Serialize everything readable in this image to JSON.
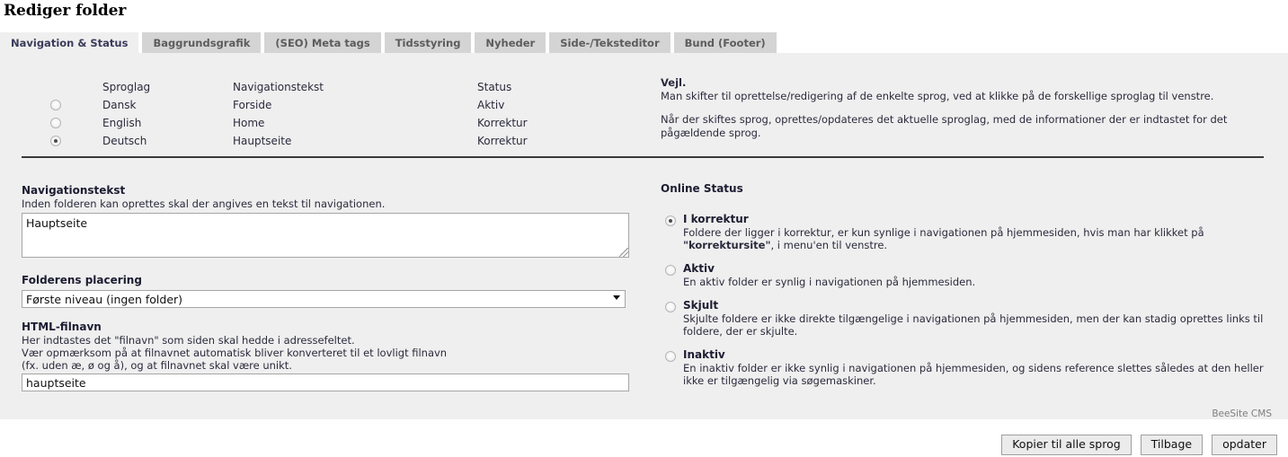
{
  "page": {
    "title": "Rediger folder",
    "brand": "BeeSite CMS"
  },
  "tabs": [
    {
      "label": "Navigation & Status",
      "active": true
    },
    {
      "label": "Baggrundsgrafik",
      "active": false
    },
    {
      "label": "(SEO) Meta tags",
      "active": false
    },
    {
      "label": "Tidsstyring",
      "active": false
    },
    {
      "label": "Nyheder",
      "active": false
    },
    {
      "label": "Side-/Teksteditor",
      "active": false
    },
    {
      "label": "Bund (Footer)",
      "active": false
    }
  ],
  "lang_table": {
    "headers": {
      "sproglag": "Sproglag",
      "navigationstekst": "Navigationstekst",
      "status": "Status"
    },
    "rows": [
      {
        "language": "Dansk",
        "nav_text": "Forside",
        "status": "Aktiv",
        "selected": false
      },
      {
        "language": "English",
        "nav_text": "Home",
        "status": "Korrektur",
        "selected": false
      },
      {
        "language": "Deutsch",
        "nav_text": "Hauptseite",
        "status": "Korrektur",
        "selected": true
      }
    ]
  },
  "vejl": {
    "title": "Vejl.",
    "line1": "Man skifter til oprettelse/redigering af de enkelte sprog, ved at klikke på de forskellige sproglag til venstre.",
    "line2": "Når der skiftes sprog, oprettes/opdateres det aktuelle sproglag, med de informationer der er indtastet for det",
    "line3": "pågældende sprog."
  },
  "form": {
    "nav_text": {
      "label": "Navigationstekst",
      "help": "Inden folderen kan oprettes skal der angives en tekst til navigationen.",
      "value": "Hauptseite"
    },
    "placement": {
      "label": "Folderens placering",
      "value": "Første niveau (ingen folder)"
    },
    "filename": {
      "label": "HTML-filnavn",
      "help1": "Her indtastes det \"filnavn\" som siden skal hedde i adressefeltet.",
      "help2": "Vær opmærksom på at filnavnet automatisk bliver konverteret til et lovligt filnavn",
      "help3": "(fx. uden æ, ø og å), og at filnavnet skal være unikt.",
      "value": "hauptseite"
    }
  },
  "online_status": {
    "title": "Online Status",
    "options": [
      {
        "name": "I korrektur",
        "desc_line1": "Foldere der ligger i korrektur, er kun synlige i navigationen på hjemmesiden, hvis man har klikket på",
        "desc_bold": "\"korrektursite\"",
        "desc_line2_rest": ", i menu'en til venstre.",
        "selected": true
      },
      {
        "name": "Aktiv",
        "desc_line1": "En aktiv folder er synlig i navigationen på hjemmesiden.",
        "desc_bold": "",
        "desc_line2_rest": "",
        "selected": false
      },
      {
        "name": "Skjult",
        "desc_line1": "Skjulte foldere er ikke direkte tilgængelige i navigationen på hjemmesiden, men der kan stadig oprettes links til",
        "desc_bold": "",
        "desc_line2_rest": "foldere, der er skjulte.",
        "selected": false
      },
      {
        "name": "Inaktiv",
        "desc_line1": "En inaktiv folder er ikke synlig i navigationen på hjemmesiden, og sidens reference slettes således at den heller",
        "desc_bold": "",
        "desc_line2_rest": "ikke er tilgængelig via søgemaskiner.",
        "selected": false
      }
    ]
  },
  "footer": {
    "buttons": [
      {
        "label": "Kopier til alle sprog"
      },
      {
        "label": "Tilbage"
      },
      {
        "label": "opdater"
      }
    ]
  }
}
